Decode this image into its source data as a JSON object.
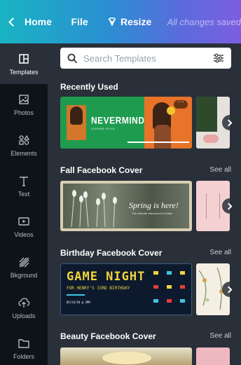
{
  "topbar": {
    "home": "Home",
    "file": "File",
    "resize": "Resize",
    "status": "All changes saved"
  },
  "sidebar": {
    "items": [
      {
        "label": "Templates",
        "icon": "templates-icon",
        "active": true
      },
      {
        "label": "Photos",
        "icon": "photos-icon"
      },
      {
        "label": "Elements",
        "icon": "elements-icon"
      },
      {
        "label": "Text",
        "icon": "text-icon"
      },
      {
        "label": "Videos",
        "icon": "videos-icon"
      },
      {
        "label": "Bkground",
        "icon": "background-icon"
      },
      {
        "label": "Uploads",
        "icon": "uploads-icon"
      },
      {
        "label": "Folders",
        "icon": "folders-icon"
      }
    ]
  },
  "search": {
    "placeholder": "Search Templates"
  },
  "sections": [
    {
      "title": "Recently Used",
      "see_all": "",
      "templates": [
        {
          "headline": "NEVERMINDER",
          "sub": "JOHANA SILVA"
        }
      ]
    },
    {
      "title": "Fall Facebook Cover",
      "see_all": "See all",
      "templates": [
        {
          "headline": "Spring is here!",
          "sub": "The ultimate reference for Easter"
        }
      ]
    },
    {
      "title": "Birthday Facebook Cover",
      "see_all": "See all",
      "templates": [
        {
          "headline": "GAME NIGHT",
          "sub": "FOR HENRY'S 33RD BIRTHDAY",
          "date": "05/24/18 @ 3PM"
        }
      ]
    },
    {
      "title": "Beauty Facebook Cover",
      "see_all": "See all",
      "templates": []
    }
  ],
  "colors": {
    "topbar_start": "#19b4c2",
    "topbar_end": "#7c5ee0",
    "panel_bg": "#293039",
    "rail_bg": "#0e1318",
    "neverminder_green": "#1e9b4f",
    "neverminder_orange": "#e8742a",
    "game_night_bg": "#0d1a2e",
    "game_night_yellow": "#f3d43b"
  }
}
